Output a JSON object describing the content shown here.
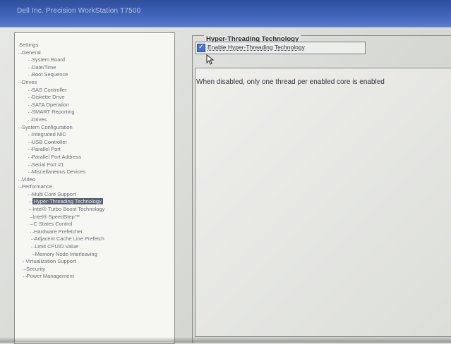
{
  "window": {
    "title": "Dell Inc. Precision WorkStation T7500"
  },
  "tree": {
    "items": [
      {
        "label": "Settings",
        "level": 0
      },
      {
        "label": "General",
        "level": 1
      },
      {
        "label": "System Board",
        "level": 2
      },
      {
        "label": "Date/Time",
        "level": 2
      },
      {
        "label": "Boot Sequence",
        "level": 2
      },
      {
        "label": "Drives",
        "level": 1
      },
      {
        "label": "SAS Controller",
        "level": 2
      },
      {
        "label": "Diskette Drive",
        "level": 2
      },
      {
        "label": "SATA Operation",
        "level": 2
      },
      {
        "label": "SMART Reporting",
        "level": 2
      },
      {
        "label": "Drives",
        "level": 2
      },
      {
        "label": "System Configuration",
        "level": 1
      },
      {
        "label": "Integrated NIC",
        "level": 2
      },
      {
        "label": "USB Controller",
        "level": 2
      },
      {
        "label": "Parallel Port",
        "level": 2
      },
      {
        "label": "Parallel Port Address",
        "level": 2
      },
      {
        "label": "Serial Port #1",
        "level": 2
      },
      {
        "label": "Miscellaneous Devices",
        "level": 2
      },
      {
        "label": "Video",
        "level": 1
      },
      {
        "label": "Performance",
        "level": 1
      },
      {
        "label": "Multi Core Support",
        "level": 2
      },
      {
        "label": "Hyper-Threading Technology",
        "level": 2,
        "selected": true
      },
      {
        "label": "Intel® Turbo Boost Technology",
        "level": 2
      },
      {
        "label": "Intel® SpeedStep™",
        "level": 2
      },
      {
        "label": "C States Control",
        "level": 2
      },
      {
        "label": "Hardware Prefetcher",
        "level": 2
      },
      {
        "label": "Adjacent Cache Line Prefetch",
        "level": 2
      },
      {
        "label": "Limit CPUID Value",
        "level": 2
      },
      {
        "label": "Memory Node Interleaving",
        "level": 2
      },
      {
        "label": "Virtualization Support",
        "level": 1
      },
      {
        "label": "Security",
        "level": 1
      },
      {
        "label": "Power Management",
        "level": 1
      }
    ]
  },
  "panel": {
    "group_title": "Hyper-Threading Technology",
    "checkbox_label": "Enable Hyper-Threading Technology",
    "checkbox_checked": true,
    "description": "When disabled, only one thread per enabled core is enabled"
  },
  "colors": {
    "titlebar": "#3f63b8",
    "selection": "#5b6170",
    "checkbox": "#4e73c7"
  }
}
